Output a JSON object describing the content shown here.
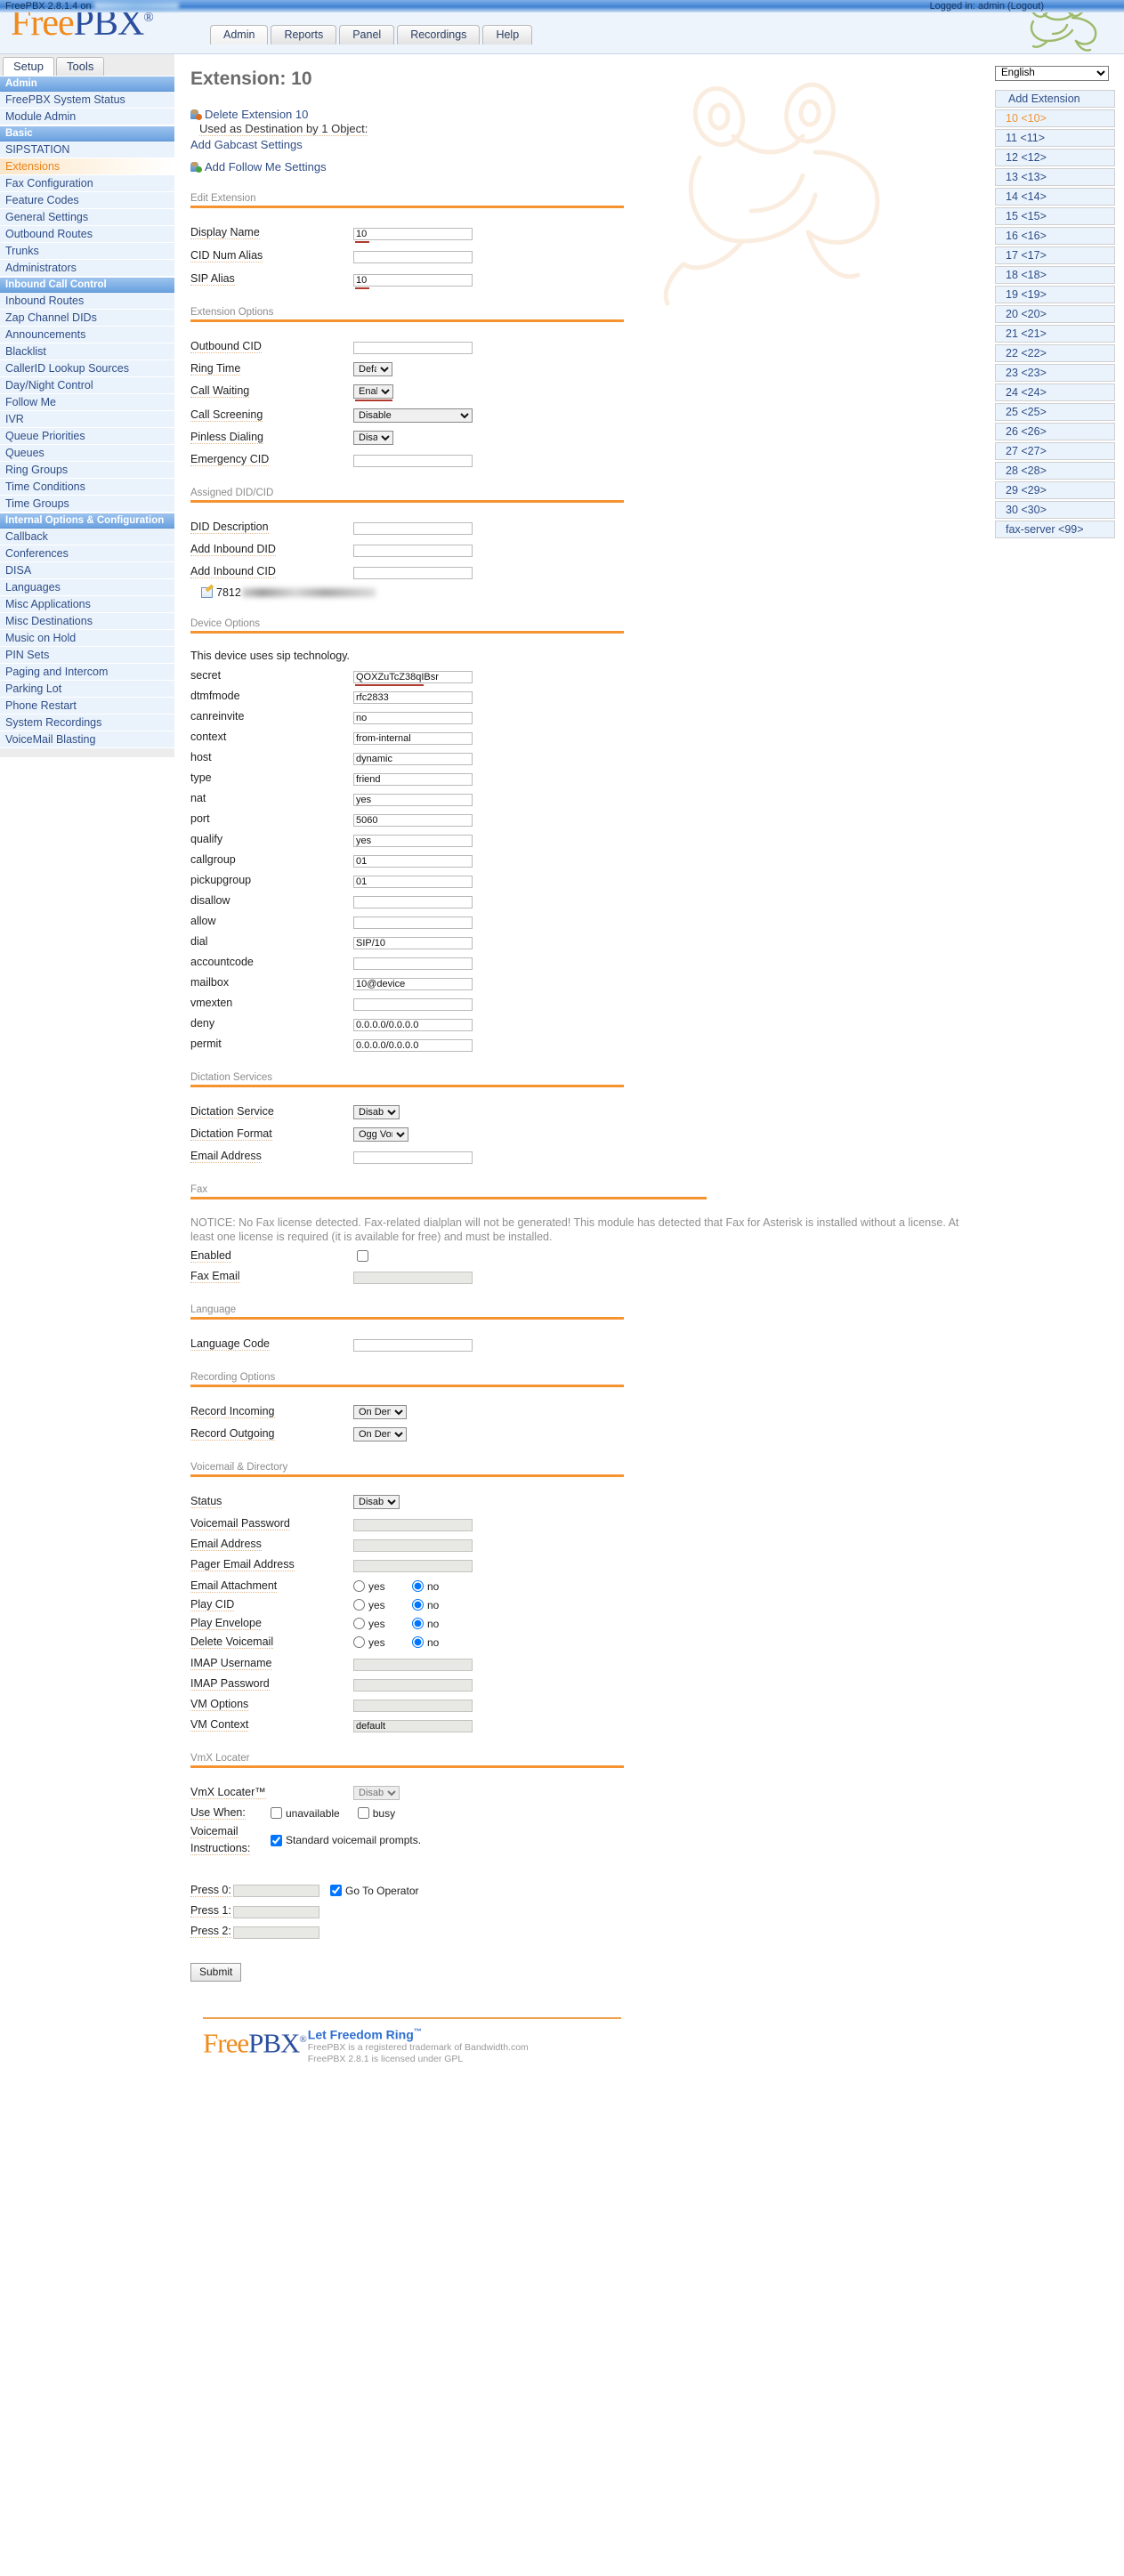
{
  "header": {
    "logo_free": "Free",
    "logo_pbx": "PBX",
    "logo_reg": "®",
    "tabs": [
      {
        "label": "Admin",
        "active": true
      },
      {
        "label": "Reports",
        "active": false
      },
      {
        "label": "Panel",
        "active": false
      },
      {
        "label": "Recordings",
        "active": false
      },
      {
        "label": "Help",
        "active": false
      }
    ],
    "version_text": "FreePBX 2.8.1.4 on",
    "login_text": "Logged in: admin (Logout)",
    "frog_icon": "frog-logo-icon"
  },
  "sidebar": {
    "mode_tabs": [
      {
        "label": "Setup",
        "active": true
      },
      {
        "label": "Tools",
        "active": false
      }
    ],
    "items": [
      {
        "label": "Admin",
        "type": "group"
      },
      {
        "label": "FreePBX System Status",
        "type": "item"
      },
      {
        "label": "Module Admin",
        "type": "item"
      },
      {
        "label": "Basic",
        "type": "group"
      },
      {
        "label": "SIPSTATION",
        "type": "item"
      },
      {
        "label": "Extensions",
        "type": "item",
        "active": true
      },
      {
        "label": "Fax Configuration",
        "type": "item"
      },
      {
        "label": "Feature Codes",
        "type": "item"
      },
      {
        "label": "General Settings",
        "type": "item"
      },
      {
        "label": "Outbound Routes",
        "type": "item"
      },
      {
        "label": "Trunks",
        "type": "item"
      },
      {
        "label": "Administrators",
        "type": "item"
      },
      {
        "label": "Inbound Call Control",
        "type": "group"
      },
      {
        "label": "Inbound Routes",
        "type": "item"
      },
      {
        "label": "Zap Channel DIDs",
        "type": "item"
      },
      {
        "label": "Announcements",
        "type": "item"
      },
      {
        "label": "Blacklist",
        "type": "item"
      },
      {
        "label": "CallerID Lookup Sources",
        "type": "item"
      },
      {
        "label": "Day/Night Control",
        "type": "item"
      },
      {
        "label": "Follow Me",
        "type": "item"
      },
      {
        "label": "IVR",
        "type": "item"
      },
      {
        "label": "Queue Priorities",
        "type": "item"
      },
      {
        "label": "Queues",
        "type": "item"
      },
      {
        "label": "Ring Groups",
        "type": "item"
      },
      {
        "label": "Time Conditions",
        "type": "item"
      },
      {
        "label": "Time Groups",
        "type": "item"
      },
      {
        "label": "Internal Options & Configuration",
        "type": "group"
      },
      {
        "label": "Callback",
        "type": "item"
      },
      {
        "label": "Conferences",
        "type": "item"
      },
      {
        "label": "DISA",
        "type": "item"
      },
      {
        "label": "Languages",
        "type": "item"
      },
      {
        "label": "Misc Applications",
        "type": "item"
      },
      {
        "label": "Misc Destinations",
        "type": "item"
      },
      {
        "label": "Music on Hold",
        "type": "item"
      },
      {
        "label": "PIN Sets",
        "type": "item"
      },
      {
        "label": "Paging and Intercom",
        "type": "item"
      },
      {
        "label": "Parking Lot",
        "type": "item"
      },
      {
        "label": "Phone Restart",
        "type": "item"
      },
      {
        "label": "System Recordings",
        "type": "item"
      },
      {
        "label": "VoiceMail Blasting",
        "type": "item"
      }
    ]
  },
  "right_panel": {
    "language_selected": "English",
    "language_options": [
      "English"
    ],
    "extensions": [
      {
        "label": "Add Extension",
        "kind": "add"
      },
      {
        "label": "10 <10>",
        "active": true
      },
      {
        "label": "11 <11>"
      },
      {
        "label": "12 <12>"
      },
      {
        "label": "13 <13>"
      },
      {
        "label": "14 <14>"
      },
      {
        "label": "15 <15>"
      },
      {
        "label": "16 <16>"
      },
      {
        "label": "17 <17>"
      },
      {
        "label": "18 <18>"
      },
      {
        "label": "19 <19>"
      },
      {
        "label": "20 <20>"
      },
      {
        "label": "21 <21>"
      },
      {
        "label": "22 <22>"
      },
      {
        "label": "23 <23>"
      },
      {
        "label": "24 <24>"
      },
      {
        "label": "25 <25>"
      },
      {
        "label": "26 <26>"
      },
      {
        "label": "27 <27>"
      },
      {
        "label": "28 <28>"
      },
      {
        "label": "29 <29>"
      },
      {
        "label": "30 <30>"
      },
      {
        "label": "fax-server <99>"
      }
    ]
  },
  "main": {
    "page_title": "Extension: 10",
    "delete_link": "Delete Extension 10",
    "used_as_destination": "Used as Destination by 1 Object:",
    "gabcast_link": "Add Gabcast Settings",
    "follow_me_link": "Add Follow Me Settings",
    "edit_extension": {
      "section_title": "Edit Extension",
      "display_name_label": "Display Name",
      "display_name_value": "10",
      "cid_num_alias_label": "CID Num Alias",
      "cid_num_alias_value": "",
      "sip_alias_label": "SIP Alias",
      "sip_alias_value": "10"
    },
    "extension_options": {
      "section_title": "Extension Options",
      "outbound_cid_label": "Outbound CID",
      "outbound_cid_value": "",
      "ring_time_label": "Ring Time",
      "ring_time_value": "Default",
      "call_waiting_label": "Call Waiting",
      "call_waiting_value": "Enable",
      "call_screening_label": "Call Screening",
      "call_screening_value": "Disable",
      "pinless_dialing_label": "Pinless Dialing",
      "pinless_dialing_value": "Disable",
      "emergency_cid_label": "Emergency CID",
      "emergency_cid_value": ""
    },
    "assigned_did_cid": {
      "section_title": "Assigned DID/CID",
      "did_description_label": "DID Description",
      "did_description_value": "",
      "add_inbound_did_label": "Add Inbound DID",
      "add_inbound_did_value": "",
      "add_inbound_cid_label": "Add Inbound CID",
      "add_inbound_cid_value": "",
      "existing_did_prefix": "7812"
    },
    "device_options": {
      "section_title": "Device Options",
      "tech_note": "This device uses sip technology.",
      "fields": [
        {
          "label": "secret",
          "value": "QOXZuTcZ38qIBsr",
          "spell": true
        },
        {
          "label": "dtmfmode",
          "value": "rfc2833"
        },
        {
          "label": "canreinvite",
          "value": "no"
        },
        {
          "label": "context",
          "value": "from-internal"
        },
        {
          "label": "host",
          "value": "dynamic"
        },
        {
          "label": "type",
          "value": "friend"
        },
        {
          "label": "nat",
          "value": "yes"
        },
        {
          "label": "port",
          "value": "5060"
        },
        {
          "label": "qualify",
          "value": "yes"
        },
        {
          "label": "callgroup",
          "value": "01"
        },
        {
          "label": "pickupgroup",
          "value": "01"
        },
        {
          "label": "disallow",
          "value": ""
        },
        {
          "label": "allow",
          "value": ""
        },
        {
          "label": "dial",
          "value": "SIP/10"
        },
        {
          "label": "accountcode",
          "value": ""
        },
        {
          "label": "mailbox",
          "value": "10@device"
        },
        {
          "label": "vmexten",
          "value": ""
        },
        {
          "label": "deny",
          "value": "0.0.0.0/0.0.0.0"
        },
        {
          "label": "permit",
          "value": "0.0.0.0/0.0.0.0"
        }
      ]
    },
    "dictation": {
      "section_title": "Dictation Services",
      "service_label": "Dictation Service",
      "service_value": "Disabled",
      "format_label": "Dictation Format",
      "format_value": "Ogg Vorbis",
      "email_label": "Email Address",
      "email_value": ""
    },
    "fax": {
      "section_title": "Fax",
      "notice": "NOTICE: No Fax license detected. Fax-related dialplan will not be generated! This module has detected that Fax for Asterisk is installed without a license. At least one license is required (it is available for free) and must be installed.",
      "enabled_label": "Enabled",
      "enabled_checked": false,
      "fax_email_label": "Fax Email",
      "fax_email_value": ""
    },
    "language": {
      "section_title": "Language",
      "code_label": "Language Code",
      "code_value": ""
    },
    "recording_options": {
      "section_title": "Recording Options",
      "record_incoming_label": "Record Incoming",
      "record_incoming_value": "On Demand",
      "record_outgoing_label": "Record Outgoing",
      "record_outgoing_value": "On Demand"
    },
    "voicemail": {
      "section_title": "Voicemail & Directory",
      "status_label": "Status",
      "status_value": "Disabled",
      "vm_password_label": "Voicemail Password",
      "vm_password_value": "",
      "email_label": "Email Address",
      "email_value": "",
      "pager_email_label": "Pager Email Address",
      "pager_email_value": "",
      "email_attachment_label": "Email Attachment",
      "email_attachment_value": "no",
      "play_cid_label": "Play CID",
      "play_cid_value": "no",
      "play_envelope_label": "Play Envelope",
      "play_envelope_value": "no",
      "delete_voicemail_label": "Delete Voicemail",
      "delete_voicemail_value": "no",
      "yes_label": "yes",
      "no_label": "no",
      "imap_username_label": "IMAP Username",
      "imap_username_value": "",
      "imap_password_label": "IMAP Password",
      "imap_password_value": "",
      "vm_options_label": "VM Options",
      "vm_options_value": "",
      "vm_context_label": "VM Context",
      "vm_context_value": "default"
    },
    "vmx_locater": {
      "section_title": "VmX Locater",
      "locater_label": "VmX Locater™",
      "locater_value": "Disabled",
      "use_when_label": "Use When:",
      "unavailable_label": "unavailable",
      "unavailable_checked": false,
      "busy_label": "busy",
      "busy_checked": false,
      "vm_instructions_label": "Voicemail Instructions:",
      "standard_prompts_label": "Standard voicemail prompts.",
      "standard_prompts_checked": true,
      "press0_label": "Press 0:",
      "press0_value": "",
      "go_to_operator_label": "Go To Operator",
      "go_to_operator_checked": true,
      "press1_label": "Press 1:",
      "press1_value": "",
      "press2_label": "Press 2:",
      "press2_value": ""
    },
    "submit_label": "Submit"
  },
  "footer": {
    "logo_free": "Free",
    "logo_pbx": "PBX",
    "logo_reg": "®",
    "tagline": "Let Freedom Ring",
    "tm": "™",
    "line1": "FreePBX is a registered trademark of Bandwidth.com",
    "line2": "FreePBX 2.8.1 is licensed under GPL"
  },
  "colors": {
    "accent_orange": "#f59331",
    "link_blue": "#2f4d86",
    "active_orange": "#e8841a",
    "group_blue": "#6ba2e0"
  }
}
